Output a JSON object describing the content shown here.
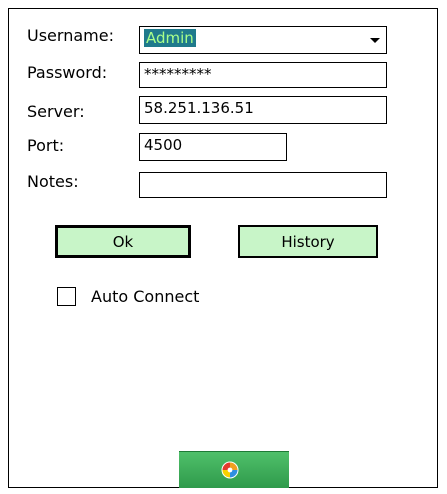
{
  "form": {
    "username": {
      "label": "Username:",
      "value": "Admin"
    },
    "password": {
      "label": "Password:",
      "value": "*********"
    },
    "server": {
      "label": "Server:",
      "value": "58.251.136.51"
    },
    "port": {
      "label": "Port:",
      "value": "4500"
    },
    "notes": {
      "label": "Notes:",
      "value": ""
    }
  },
  "buttons": {
    "ok": "Ok",
    "history": "History"
  },
  "auto_connect": {
    "label": "Auto Connect",
    "checked": false
  },
  "start_bar": {
    "icon": "windows-start-icon"
  },
  "colors": {
    "button_fill": "#c8f5c8",
    "selection_bg": "#1f7a8c",
    "selection_text": "#a8ff8a",
    "start_bar": "#3aa957"
  }
}
